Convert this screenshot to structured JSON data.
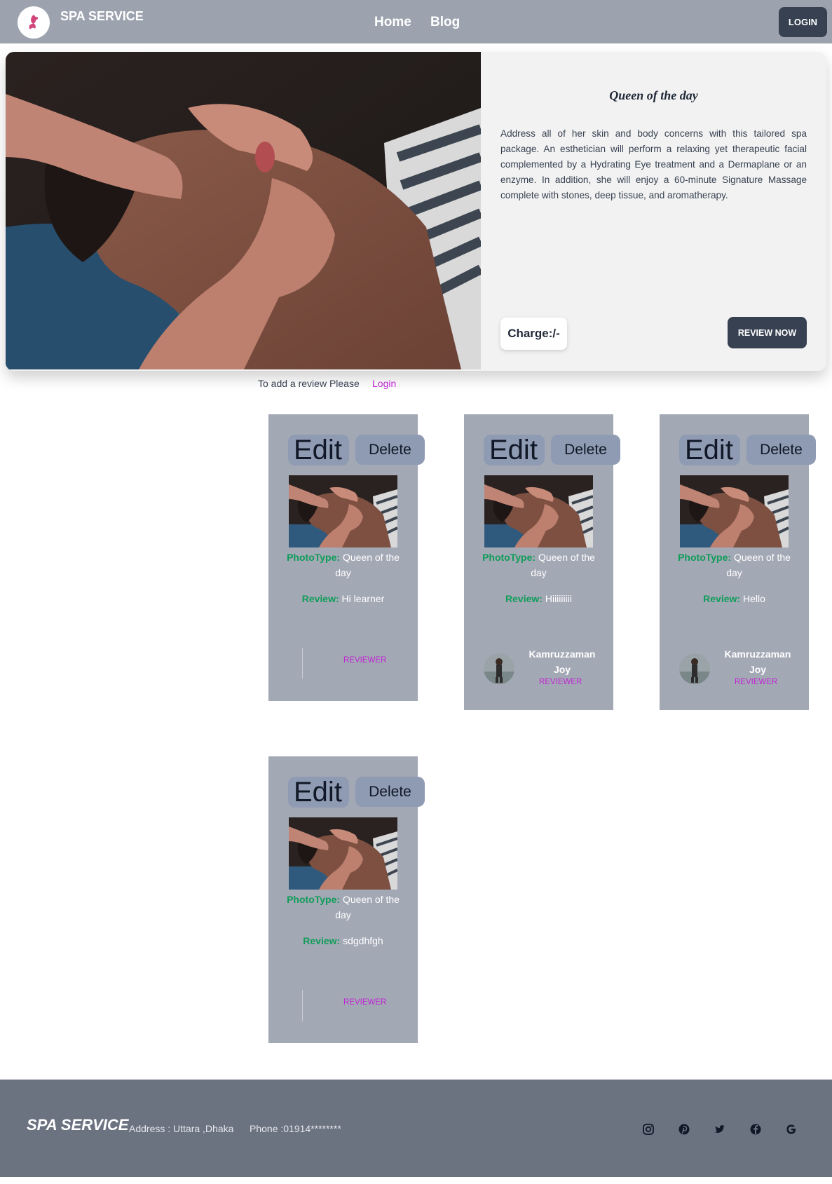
{
  "nav": {
    "brand": "SPA SERVICE",
    "links": [
      "Home",
      "Blog"
    ],
    "login": "LOGIN"
  },
  "hero": {
    "title": "Queen of the day",
    "description": "Address all of her skin and body concerns with this tailored spa package. An esthetician will perform a relaxing yet therapeutic facial complemented by a Hydrating Eye treatment and a Dermaplane or an enzyme. In addition, she will enjoy a 60-minute Signature Massage complete with stones, deep tissue, and aromatherapy.",
    "charge": "Charge:/-",
    "review_button": "REVIEW NOW"
  },
  "review_prompt": {
    "text": "To add a review Please",
    "link": "Login"
  },
  "cards": [
    {
      "edit": "Edit",
      "delete": "Delete",
      "photo_type_label": "PhotoType:",
      "photo_type": "Queen of the day",
      "review_label": "Review:",
      "review": "Hi learner",
      "name": "",
      "role": "REVIEWER"
    },
    {
      "edit": "Edit",
      "delete": "Delete",
      "photo_type_label": "PhotoType:",
      "photo_type": "Queen of the day",
      "review_label": "Review:",
      "review": "Hiiiiiiiii",
      "name": "Kamruzzaman Joy",
      "role": "REVIEWER"
    },
    {
      "edit": "Edit",
      "delete": "Delete",
      "photo_type_label": "PhotoType:",
      "photo_type": "Queen of the day",
      "review_label": "Review:",
      "review": "Hello",
      "name": "Kamruzzaman Joy",
      "role": "REVIEWER"
    },
    {
      "edit": "Edit",
      "delete": "Delete",
      "photo_type_label": "PhotoType:",
      "photo_type": "Queen of the day",
      "review_label": "Review:",
      "review": "sdgdhfgh",
      "name": "",
      "role": "REVIEWER"
    }
  ],
  "footer": {
    "brand": "SPA SERVICE",
    "address": "Address : Uttara ,Dhaka",
    "phone": "Phone :01914********",
    "social_icons": [
      "instagram-icon",
      "pinterest-icon",
      "twitter-icon",
      "facebook-icon",
      "google-icon"
    ]
  },
  "colors": {
    "navbar": "#9ca3af",
    "dark_button": "#374151",
    "accent_pink": "#c026d3",
    "label_green": "#0f9d58",
    "card_bg": "#a3a8b5",
    "footer": "#6b7280"
  }
}
